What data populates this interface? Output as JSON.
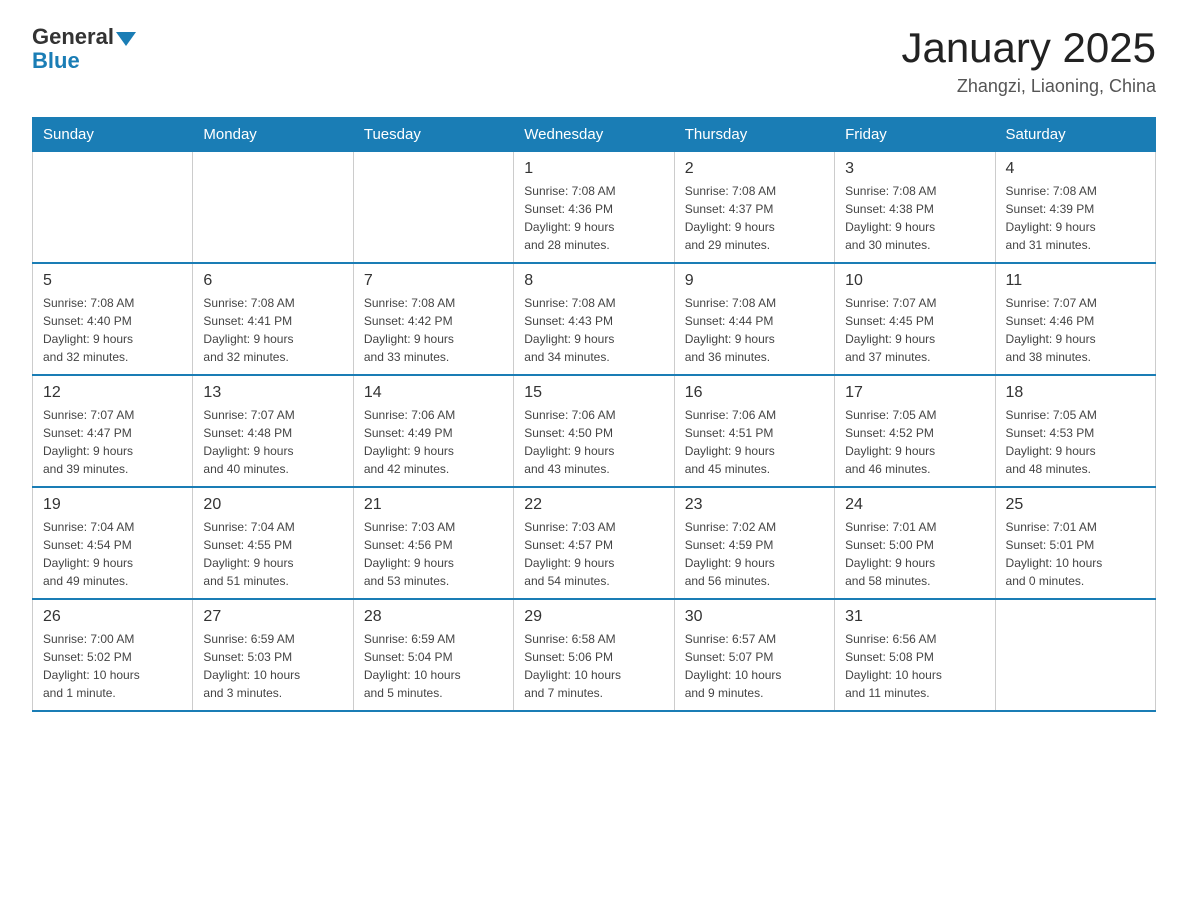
{
  "logo": {
    "general": "General",
    "blue": "Blue"
  },
  "header": {
    "title": "January 2025",
    "subtitle": "Zhangzi, Liaoning, China"
  },
  "weekdays": [
    "Sunday",
    "Monday",
    "Tuesday",
    "Wednesday",
    "Thursday",
    "Friday",
    "Saturday"
  ],
  "weeks": [
    [
      {
        "day": "",
        "info": ""
      },
      {
        "day": "",
        "info": ""
      },
      {
        "day": "",
        "info": ""
      },
      {
        "day": "1",
        "info": "Sunrise: 7:08 AM\nSunset: 4:36 PM\nDaylight: 9 hours\nand 28 minutes."
      },
      {
        "day": "2",
        "info": "Sunrise: 7:08 AM\nSunset: 4:37 PM\nDaylight: 9 hours\nand 29 minutes."
      },
      {
        "day": "3",
        "info": "Sunrise: 7:08 AM\nSunset: 4:38 PM\nDaylight: 9 hours\nand 30 minutes."
      },
      {
        "day": "4",
        "info": "Sunrise: 7:08 AM\nSunset: 4:39 PM\nDaylight: 9 hours\nand 31 minutes."
      }
    ],
    [
      {
        "day": "5",
        "info": "Sunrise: 7:08 AM\nSunset: 4:40 PM\nDaylight: 9 hours\nand 32 minutes."
      },
      {
        "day": "6",
        "info": "Sunrise: 7:08 AM\nSunset: 4:41 PM\nDaylight: 9 hours\nand 32 minutes."
      },
      {
        "day": "7",
        "info": "Sunrise: 7:08 AM\nSunset: 4:42 PM\nDaylight: 9 hours\nand 33 minutes."
      },
      {
        "day": "8",
        "info": "Sunrise: 7:08 AM\nSunset: 4:43 PM\nDaylight: 9 hours\nand 34 minutes."
      },
      {
        "day": "9",
        "info": "Sunrise: 7:08 AM\nSunset: 4:44 PM\nDaylight: 9 hours\nand 36 minutes."
      },
      {
        "day": "10",
        "info": "Sunrise: 7:07 AM\nSunset: 4:45 PM\nDaylight: 9 hours\nand 37 minutes."
      },
      {
        "day": "11",
        "info": "Sunrise: 7:07 AM\nSunset: 4:46 PM\nDaylight: 9 hours\nand 38 minutes."
      }
    ],
    [
      {
        "day": "12",
        "info": "Sunrise: 7:07 AM\nSunset: 4:47 PM\nDaylight: 9 hours\nand 39 minutes."
      },
      {
        "day": "13",
        "info": "Sunrise: 7:07 AM\nSunset: 4:48 PM\nDaylight: 9 hours\nand 40 minutes."
      },
      {
        "day": "14",
        "info": "Sunrise: 7:06 AM\nSunset: 4:49 PM\nDaylight: 9 hours\nand 42 minutes."
      },
      {
        "day": "15",
        "info": "Sunrise: 7:06 AM\nSunset: 4:50 PM\nDaylight: 9 hours\nand 43 minutes."
      },
      {
        "day": "16",
        "info": "Sunrise: 7:06 AM\nSunset: 4:51 PM\nDaylight: 9 hours\nand 45 minutes."
      },
      {
        "day": "17",
        "info": "Sunrise: 7:05 AM\nSunset: 4:52 PM\nDaylight: 9 hours\nand 46 minutes."
      },
      {
        "day": "18",
        "info": "Sunrise: 7:05 AM\nSunset: 4:53 PM\nDaylight: 9 hours\nand 48 minutes."
      }
    ],
    [
      {
        "day": "19",
        "info": "Sunrise: 7:04 AM\nSunset: 4:54 PM\nDaylight: 9 hours\nand 49 minutes."
      },
      {
        "day": "20",
        "info": "Sunrise: 7:04 AM\nSunset: 4:55 PM\nDaylight: 9 hours\nand 51 minutes."
      },
      {
        "day": "21",
        "info": "Sunrise: 7:03 AM\nSunset: 4:56 PM\nDaylight: 9 hours\nand 53 minutes."
      },
      {
        "day": "22",
        "info": "Sunrise: 7:03 AM\nSunset: 4:57 PM\nDaylight: 9 hours\nand 54 minutes."
      },
      {
        "day": "23",
        "info": "Sunrise: 7:02 AM\nSunset: 4:59 PM\nDaylight: 9 hours\nand 56 minutes."
      },
      {
        "day": "24",
        "info": "Sunrise: 7:01 AM\nSunset: 5:00 PM\nDaylight: 9 hours\nand 58 minutes."
      },
      {
        "day": "25",
        "info": "Sunrise: 7:01 AM\nSunset: 5:01 PM\nDaylight: 10 hours\nand 0 minutes."
      }
    ],
    [
      {
        "day": "26",
        "info": "Sunrise: 7:00 AM\nSunset: 5:02 PM\nDaylight: 10 hours\nand 1 minute."
      },
      {
        "day": "27",
        "info": "Sunrise: 6:59 AM\nSunset: 5:03 PM\nDaylight: 10 hours\nand 3 minutes."
      },
      {
        "day": "28",
        "info": "Sunrise: 6:59 AM\nSunset: 5:04 PM\nDaylight: 10 hours\nand 5 minutes."
      },
      {
        "day": "29",
        "info": "Sunrise: 6:58 AM\nSunset: 5:06 PM\nDaylight: 10 hours\nand 7 minutes."
      },
      {
        "day": "30",
        "info": "Sunrise: 6:57 AM\nSunset: 5:07 PM\nDaylight: 10 hours\nand 9 minutes."
      },
      {
        "day": "31",
        "info": "Sunrise: 6:56 AM\nSunset: 5:08 PM\nDaylight: 10 hours\nand 11 minutes."
      },
      {
        "day": "",
        "info": ""
      }
    ]
  ]
}
